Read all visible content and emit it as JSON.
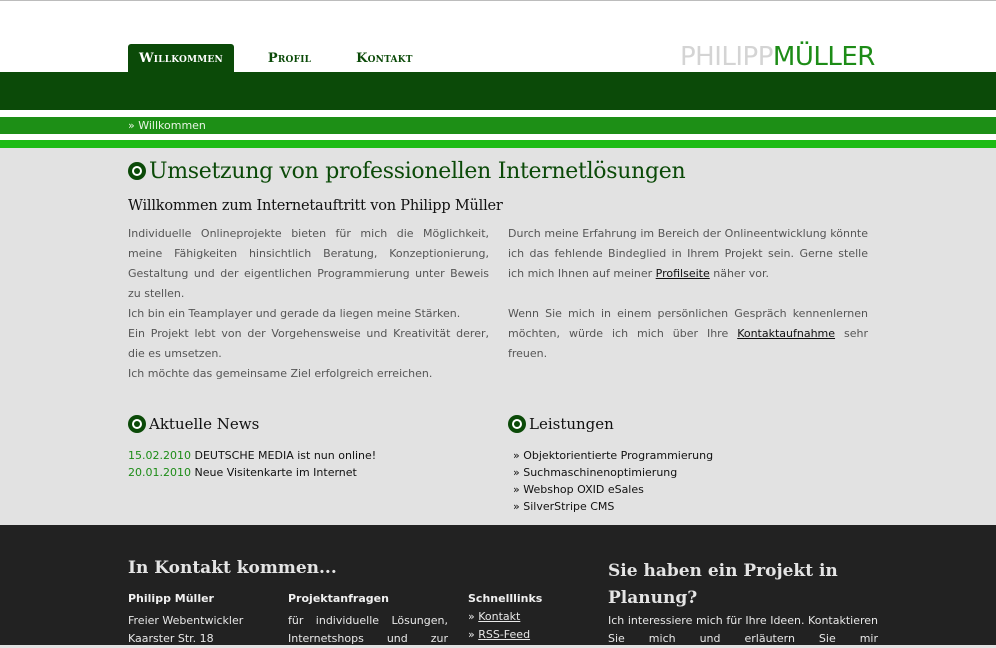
{
  "nav": {
    "items": [
      {
        "label": "Willkommen",
        "active": true
      },
      {
        "label": "Profil",
        "active": false
      },
      {
        "label": "Kontakt",
        "active": false
      }
    ]
  },
  "logo": {
    "first": "PHILIPP",
    "last": "MÜLLER"
  },
  "breadcrumb": "» Willkommen",
  "main": {
    "title": "Umsetzung von professionellen Internetlösungen",
    "subtitle": "Willkommen zum Internetauftritt von Philipp Müller",
    "left": {
      "p1": "Individuelle Onlineprojekte bieten für mich die Möglichkeit, meine Fähigkeiten hinsichtlich Beratung, Konzeptionierung, Gestaltung und der eigentlichen Programmierung unter Beweis zu stellen.",
      "p2": "Ich bin ein Teamplayer und gerade da liegen meine Stärken.",
      "p3": "Ein Projekt lebt von der Vorgehensweise und Kreativität derer, die es umsetzen.",
      "p4": "Ich möchte das gemeinsame Ziel erfolgreich erreichen."
    },
    "right": {
      "p1_before": "Durch meine Erfahrung im Bereich der Onlineentwicklung könnte ich das fehlende Bindeglied in Ihrem Projekt sein. Gerne stelle ich mich Ihnen auf meiner ",
      "p1_link": "Profilseite",
      "p1_after": " näher vor.",
      "p2_before": "Wenn Sie mich in einem persönlichen Gespräch kennenlernen möchten, würde ich mich über Ihre ",
      "p2_link": "Kontaktaufnahme",
      "p2_after": " sehr freuen."
    }
  },
  "news": {
    "title": "Aktuelle News",
    "items": [
      {
        "date": "15.02.2010",
        "text": "DEUTSCHE MEDIA ist nun online!"
      },
      {
        "date": "20.01.2010",
        "text": "Neue Visitenkarte im Internet"
      }
    ]
  },
  "services": {
    "title": "Leistungen",
    "items": [
      "» Objektorientierte Programmierung",
      "» Suchmaschinenoptimierung",
      "» Webshop OXID eSales",
      "» SilverStripe CMS"
    ]
  },
  "footer": {
    "contact_title": "In Kontakt kommen...",
    "person": {
      "name": "Philipp Müller",
      "line1": "Freier Webentwickler",
      "line2": "Kaarster Str. 18"
    },
    "projects": {
      "title": "Projektanfragen",
      "text": "für individuelle Lösungen, Internetshops und zur"
    },
    "quicklinks": {
      "title": "Schnelllinks",
      "items": [
        {
          "prefix": "» ",
          "label": "Kontakt"
        },
        {
          "prefix": "» ",
          "label": "RSS-Feed"
        }
      ]
    },
    "project_title": "Sie haben ein Projekt in Planung?",
    "project_text": "Ich interessiere mich für Ihre Ideen. Kontaktieren Sie mich und erläutern Sie mir"
  },
  "colors": {
    "dark_green": "#0b4a08",
    "mid_green": "#1d8f16",
    "light_green": "#1dbb14",
    "footer_bg": "#222222"
  }
}
